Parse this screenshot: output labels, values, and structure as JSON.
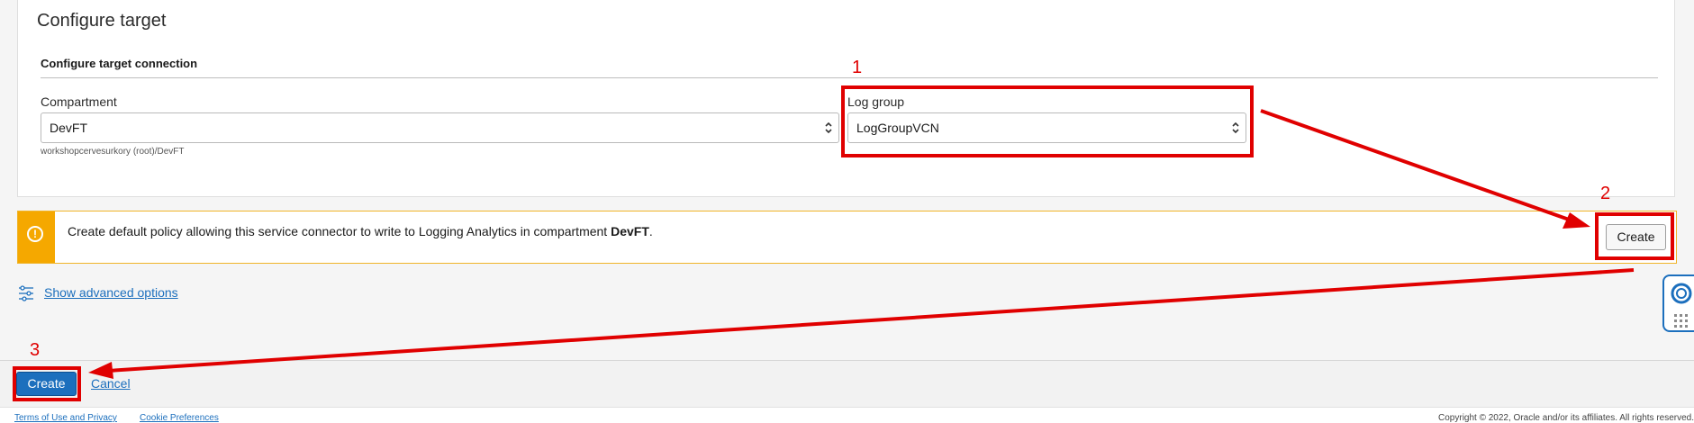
{
  "card": {
    "title": "Configure target",
    "section_title": "Configure target connection",
    "compartment": {
      "label": "Compartment",
      "value": "DevFT",
      "hint": "workshopcervesurkory (root)/DevFT"
    },
    "log_group": {
      "label": "Log group",
      "value": "LogGroupVCN"
    }
  },
  "warning": {
    "text_prefix": "Create default policy allowing this service connector to write to Logging Analytics in compartment ",
    "text_bold": "DevFT",
    "text_suffix": ".",
    "create_label": "Create",
    "icon": "alert-icon",
    "accent_color": "#f5a800"
  },
  "advanced": {
    "label": "Show advanced options",
    "icon": "sliders-icon"
  },
  "actions": {
    "create_label": "Create",
    "cancel_label": "Cancel",
    "primary_color": "#1c6fbd"
  },
  "footer": {
    "terms": "Terms of Use and Privacy",
    "cookies": "Cookie Preferences",
    "copyright": "Copyright © 2022, Oracle and/or its affiliates. All rights reserved."
  },
  "annotations": {
    "color": "#e00000",
    "numbers": [
      "1",
      "2",
      "3"
    ]
  },
  "help_widget": {
    "icon": "lifebuoy-icon",
    "grid_icon": "apps-grid-icon"
  }
}
